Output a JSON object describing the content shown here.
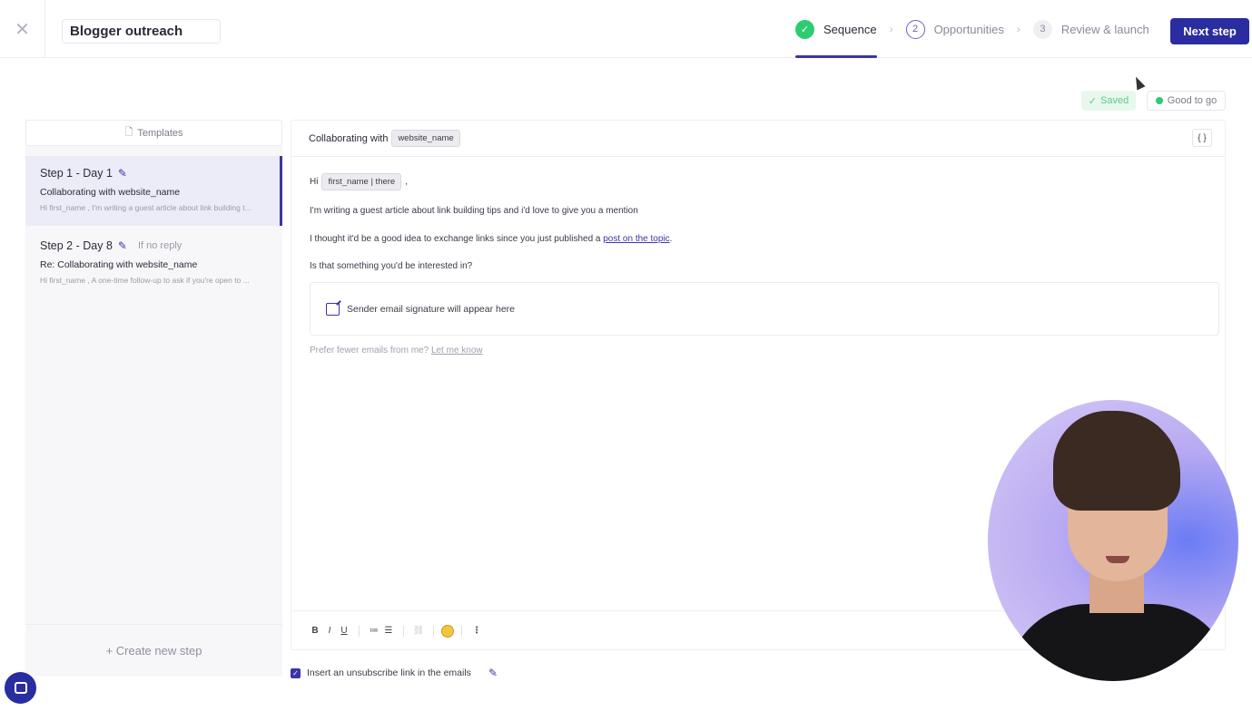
{
  "topbar": {
    "campaign_name": "Blogger outreach",
    "steps": [
      {
        "label": "Sequence",
        "state": "done"
      },
      {
        "number": "2",
        "label": "Opportunities"
      },
      {
        "number": "3",
        "label": "Review & launch"
      }
    ],
    "next_label": "Next step"
  },
  "status": {
    "saved": "Saved",
    "good": "Good to go"
  },
  "sidebar": {
    "templates_label": "Templates",
    "steps": [
      {
        "title": "Step 1 - Day 1",
        "subject": "Collaborating with website_name",
        "preview": "Hi first_name , I'm writing a guest article about link building t..."
      },
      {
        "title": "Step 2 - Day 8",
        "condition": "If no reply",
        "subject": "Re: Collaborating with website_name",
        "preview": "Hi first_name , A one-time follow-up to ask if you're open to ..."
      }
    ],
    "create_label": "+  Create new step"
  },
  "editor": {
    "subject_prefix": "Collaborating with",
    "subject_var": "website_name",
    "braces": "{ }",
    "greeting": "Hi",
    "greeting_var": "first_name | there",
    "greeting_end": ",",
    "line1": "I'm writing a guest article about link building tips and i'd love to give you a mention",
    "line2_prefix": "I thought it'd be a good idea to exchange links since you just published a",
    "line2_link": "post on the topic",
    "line2_suffix": ".",
    "line3": "Is that something you'd be interested in?",
    "signature": "Sender email signature will appear here",
    "unsub_prefix": "Prefer fewer emails from me?",
    "unsub_link": "Let me know"
  },
  "toolbar": {
    "bold": "B",
    "italic": "I",
    "underline": "U",
    "more": "⋮"
  },
  "footer": {
    "unsubscribe_label": "Insert an unsubscribe link in the emails"
  },
  "colors": {
    "accent": "#2a2da0",
    "success": "#2ecc71"
  }
}
